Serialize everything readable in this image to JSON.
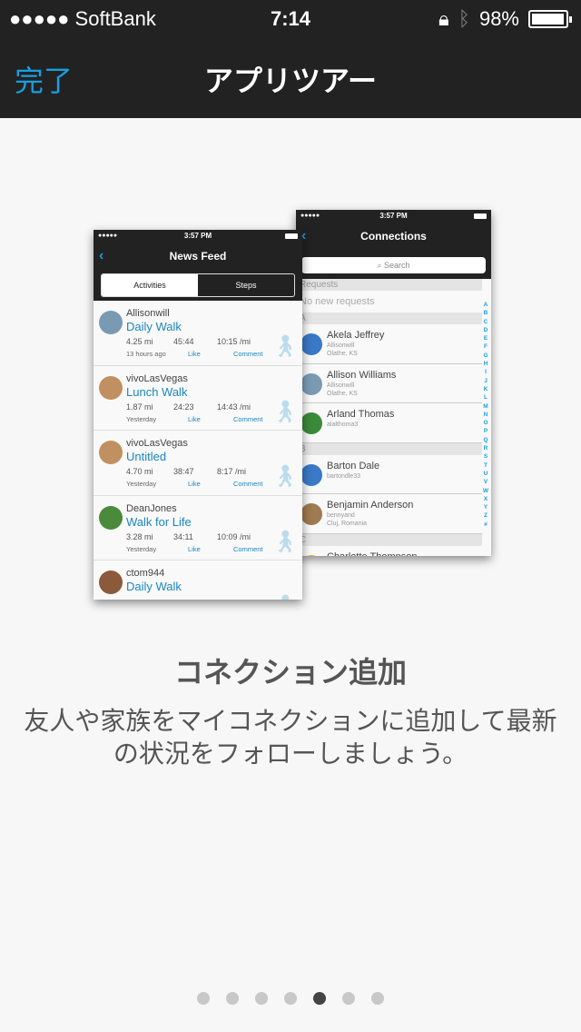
{
  "status_bar": {
    "carrier": "●●●●● SoftBank",
    "time": "7:14",
    "battery": "98%",
    "battery_level": 0.98
  },
  "nav": {
    "done": "完了",
    "title": "アプリツアー"
  },
  "feed": {
    "time": "3:57 PM",
    "title": "News Feed",
    "tabs": [
      "Activities",
      "Steps"
    ],
    "items": [
      {
        "user": "Allisonwill",
        "activity": "Daily Walk",
        "dist": "4.25 mi",
        "dur": "45:44",
        "pace": "10:15 /mi",
        "when": "13 hours ago",
        "color": "#7a9ab4"
      },
      {
        "user": "vivoLasVegas",
        "activity": "Lunch Walk",
        "dist": "1.87 mi",
        "dur": "24:23",
        "pace": "14:43 /mi",
        "when": "Yesterday",
        "color": "#c09060"
      },
      {
        "user": "vivoLasVegas",
        "activity": "Untitled",
        "dist": "4.70 mi",
        "dur": "38:47",
        "pace": "8:17 /mi",
        "when": "Yesterday",
        "color": "#c09060"
      },
      {
        "user": "DeanJones",
        "activity": "Walk for Life",
        "dist": "3.28 mi",
        "dur": "34:11",
        "pace": "10:09 /mi",
        "when": "Yesterday",
        "color": "#4a8a3a"
      },
      {
        "user": "ctom944",
        "activity": "Daily Walk",
        "color": "#8a5a3a"
      }
    ],
    "like": "Like",
    "comment": "Comment"
  },
  "conn": {
    "time": "3:57 PM",
    "title": "Connections",
    "search": "Search",
    "requests": "Requests",
    "no_requests": "No new requests",
    "sections": [
      {
        "letter": "A",
        "people": [
          {
            "name": "Akela Jeffrey",
            "sub1": "Allisonwill",
            "sub2": "Olathe, KS",
            "color": "#3a78c8"
          },
          {
            "name": "Allison Williams",
            "sub1": "Allisonwill",
            "sub2": "Olathe, KS",
            "color": "#7a9ab4"
          },
          {
            "name": "Arland Thomas",
            "sub1": "alalthoma3",
            "color": "#3a8a3a"
          }
        ]
      },
      {
        "letter": "B",
        "people": [
          {
            "name": "Barton Dale",
            "sub1": "bartondle33",
            "color": "#3a78c8"
          },
          {
            "name": "Benjamin Anderson",
            "sub1": "bennyand",
            "sub2": "Cluj, Romania",
            "color": "#a07a50"
          }
        ]
      },
      {
        "letter": "C",
        "people": [
          {
            "name": "Charlotte Thompson",
            "color": "#e0b020"
          }
        ]
      }
    ],
    "index": "ABCDEFGHIJKLMNOPQRSTUVWXYZ#"
  },
  "heading": "コネクション追加",
  "description": "友人や家族をマイコネクションに追加して最新の状況をフォローしましょう。",
  "pagination": {
    "count": 7,
    "current": 5
  }
}
